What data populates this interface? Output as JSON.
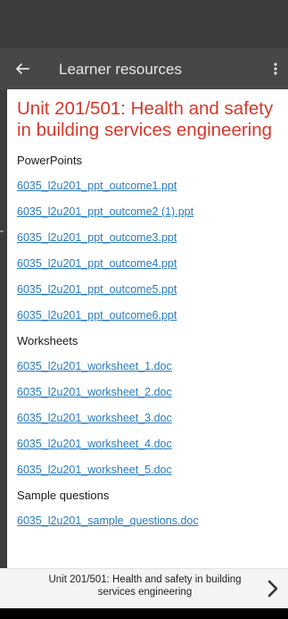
{
  "appbar": {
    "title": "Learner resources",
    "back_icon": "arrow-left-icon",
    "menu_icon": "more-vertical-icon"
  },
  "page": {
    "heading": "Unit 201/501: Health and safety in building services engineering"
  },
  "sections": [
    {
      "title": "PowerPoints",
      "links": [
        "6035_l2u201_ppt_outcome1.ppt",
        "6035_l2u201_ppt_outcome2 (1).ppt",
        "6035_l2u201_ppt_outcome3.ppt",
        "6035_l2u201_ppt_outcome4.ppt",
        "6035_l2u201_ppt_outcome5.ppt",
        "6035_l2u201_ppt_outcome6.ppt"
      ]
    },
    {
      "title": "Worksheets",
      "links": [
        "6035_l2u201_worksheet_1.doc",
        "6035_l2u201_worksheet_2.doc",
        "6035_l2u201_worksheet_3.doc",
        "6035_l2u201_worksheet_4.doc",
        "6035_l2u201_worksheet_5.doc"
      ]
    },
    {
      "title": "Sample questions",
      "links": [
        "6035_l2u201_sample_questions.doc"
      ]
    }
  ],
  "footer": {
    "next_label": "Unit 201/501: Health and safety in building services engineering",
    "next_icon": "chevron-right-icon"
  },
  "colors": {
    "heading": "#d6382a",
    "link": "#2a7bbd",
    "appbar": "#474747",
    "statusbar": "#3c3c3c"
  }
}
